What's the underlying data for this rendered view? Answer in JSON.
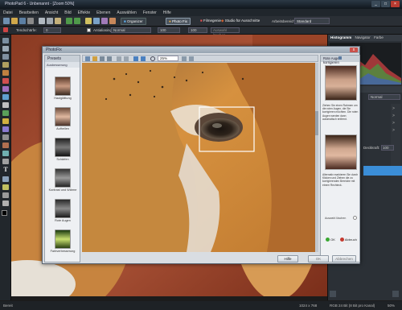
{
  "app": {
    "title": "PhotoPad 6 - Unbenannt - [Zoom 50%]",
    "menu": [
      "Datei",
      "Bearbeiten",
      "Ansicht",
      "Bild",
      "Effekte",
      "Ebenen",
      "Auswählen",
      "Fenster",
      "Hilfe"
    ]
  },
  "toolbar": {
    "buttons": [
      "Photo Fix",
      "Organizer",
      "Filmegenie",
      "Studio für Ausschnitte"
    ],
    "workspace_label": "Arbeitsbereich:",
    "workspace_value": "Standard"
  },
  "options_bar": {
    "tolerance_label": "Tendschärfe:",
    "tolerance_value": "0",
    "antialias_label": "Antialiasing",
    "mode_value": "Normal",
    "opacity_value": "100",
    "extra_label": "Auswahl löschen"
  },
  "right_panel": {
    "histogram_label": "Histogramm",
    "tabs": [
      "Navigator",
      "Farbe"
    ],
    "layers_label": "Ebenen",
    "blend_value": "Normal",
    "opacity_label": "Deckkraft:",
    "opacity_value": "100"
  },
  "status": {
    "left": "Bereit",
    "size": "1024 x 768",
    "mode": "RGB 24 Bit (8 Bit pro Kanal)",
    "zoom": "50%"
  },
  "dialog": {
    "title": "PhotoFix",
    "close_label": "x",
    "presets_tab": "Presets",
    "group_label": "Ausbesserung",
    "presets": [
      {
        "label": "Hautglättung"
      },
      {
        "label": "Aufhellen"
      },
      {
        "label": "Schärfen"
      },
      {
        "label": "Kontrast und Wärme"
      },
      {
        "label": "Rote Augen"
      },
      {
        "label": "Farbverbesserung"
      }
    ],
    "zoom_value": "25%",
    "side": {
      "title": "Rote Augen korrigieren",
      "description": "Ziehen Sie einen Rahmen um die roten Augen, die Sie korrigieren möchten. Die roten Augen werden dann automatisch entfernt.",
      "hint": "Alternativ markieren Sie durch Klicken und Ziehen die zu korrigierenden Bereiche mit einem Rechteck.",
      "checkbox_label": "Auswahl löschen",
      "ok_label": "OK",
      "cancel_label": "Abbruch"
    },
    "buttons": {
      "help": "Hilfe",
      "ok": "OK",
      "cancel": "Abbrechen"
    }
  },
  "colors": {
    "accent": "#3b8ed8",
    "ok_green": "#3aa832",
    "cancel_red": "#c53a2f"
  }
}
